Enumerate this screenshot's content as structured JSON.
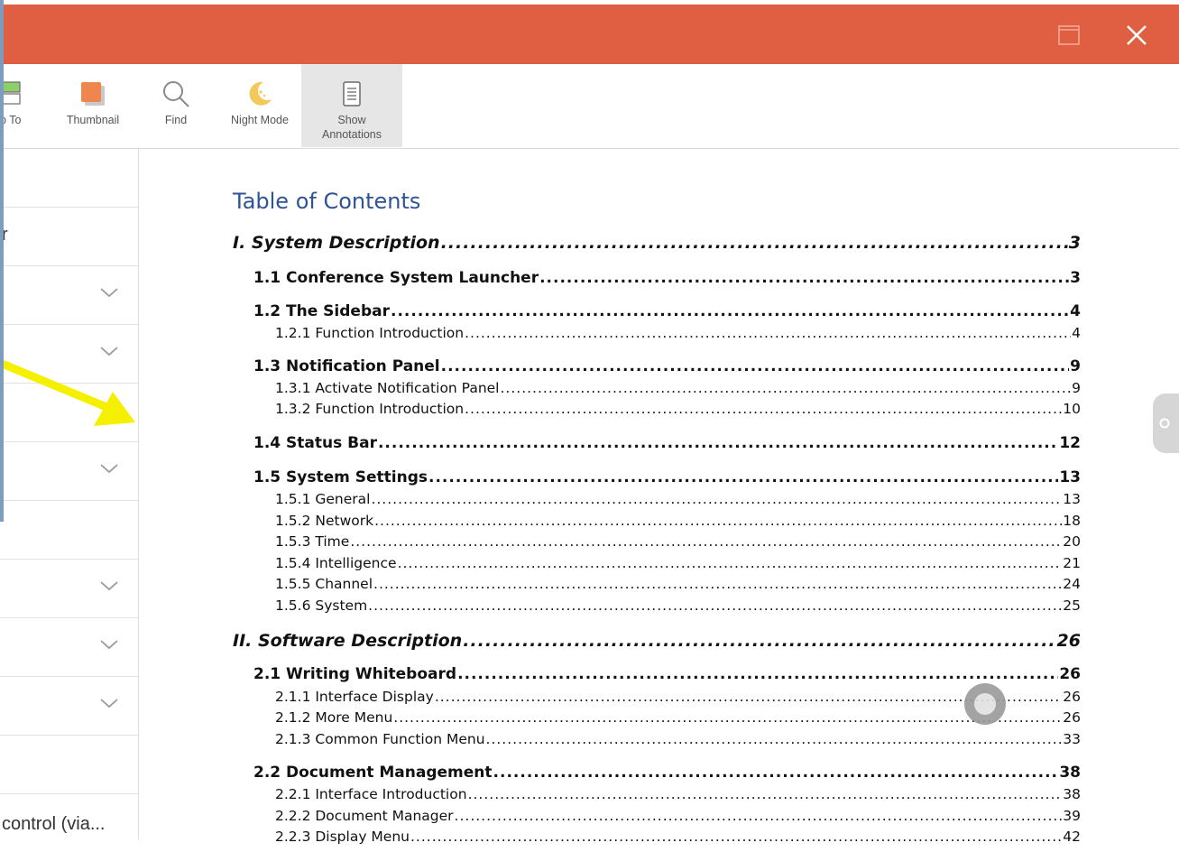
{
  "toolbar": {
    "jump_to_label": "p To",
    "thumbnail_label": "Thumbnail",
    "find_label": "Find",
    "night_mode_label": "Night Mode",
    "show_annotations_label": "Show\nAnnotations"
  },
  "sidebar": {
    "row2_text": "r",
    "bottom_text": "control (via..."
  },
  "document": {
    "toc_title": "Table of Contents",
    "entries": [
      {
        "level": 1,
        "text": "I. System Description",
        "page": "3"
      },
      {
        "level": 2,
        "text": "1.1 Conference System Launcher",
        "page": "3"
      },
      {
        "level": 2,
        "text": "1.2 The Sidebar",
        "page": "4"
      },
      {
        "level": 3,
        "text": "1.2.1 Function Introduction",
        "page": "4"
      },
      {
        "level": 2,
        "text": "1.3 Notification Panel",
        "page": "9"
      },
      {
        "level": 3,
        "text": "1.3.1 Activate Notification Panel",
        "page": "9"
      },
      {
        "level": 3,
        "text": "1.3.2 Function Introduction",
        "page": "10"
      },
      {
        "level": 2,
        "text": "1.4 Status Bar",
        "page": "12"
      },
      {
        "level": 2,
        "text": "1.5 System Settings",
        "page": "13"
      },
      {
        "level": 3,
        "text": "1.5.1 General",
        "page": "13"
      },
      {
        "level": 3,
        "text": "1.5.2 Network",
        "page": "18"
      },
      {
        "level": 3,
        "text": "1.5.3 Time",
        "page": "20"
      },
      {
        "level": 3,
        "text": "1.5.4 Intelligence",
        "page": "21"
      },
      {
        "level": 3,
        "text": "1.5.5 Channel",
        "page": "24"
      },
      {
        "level": 3,
        "text": "1.5.6 System",
        "page": "25"
      },
      {
        "level": 1,
        "text": "II. Software Description",
        "page": "26"
      },
      {
        "level": 2,
        "text": "2.1 Writing Whiteboard",
        "page": "26"
      },
      {
        "level": 3,
        "text": "2.1.1 Interface Display",
        "page": "26"
      },
      {
        "level": 3,
        "text": "2.1.2 More Menu",
        "page": "26"
      },
      {
        "level": 3,
        "text": "2.1.3 Common Function Menu",
        "page": "33"
      },
      {
        "level": 2,
        "text": "2.2 Document Management",
        "page": "38"
      },
      {
        "level": 3,
        "text": "2.2.1 Interface Introduction",
        "page": "38"
      },
      {
        "level": 3,
        "text": "2.2.2 Document Manager",
        "page": "39"
      },
      {
        "level": 3,
        "text": "2.2.3 Display Menu",
        "page": "42"
      }
    ]
  },
  "colors": {
    "titlebar": "#e05f42",
    "toc_title": "#2f5496",
    "arrow": "#f4f000",
    "frame": "#7d9cc0"
  }
}
